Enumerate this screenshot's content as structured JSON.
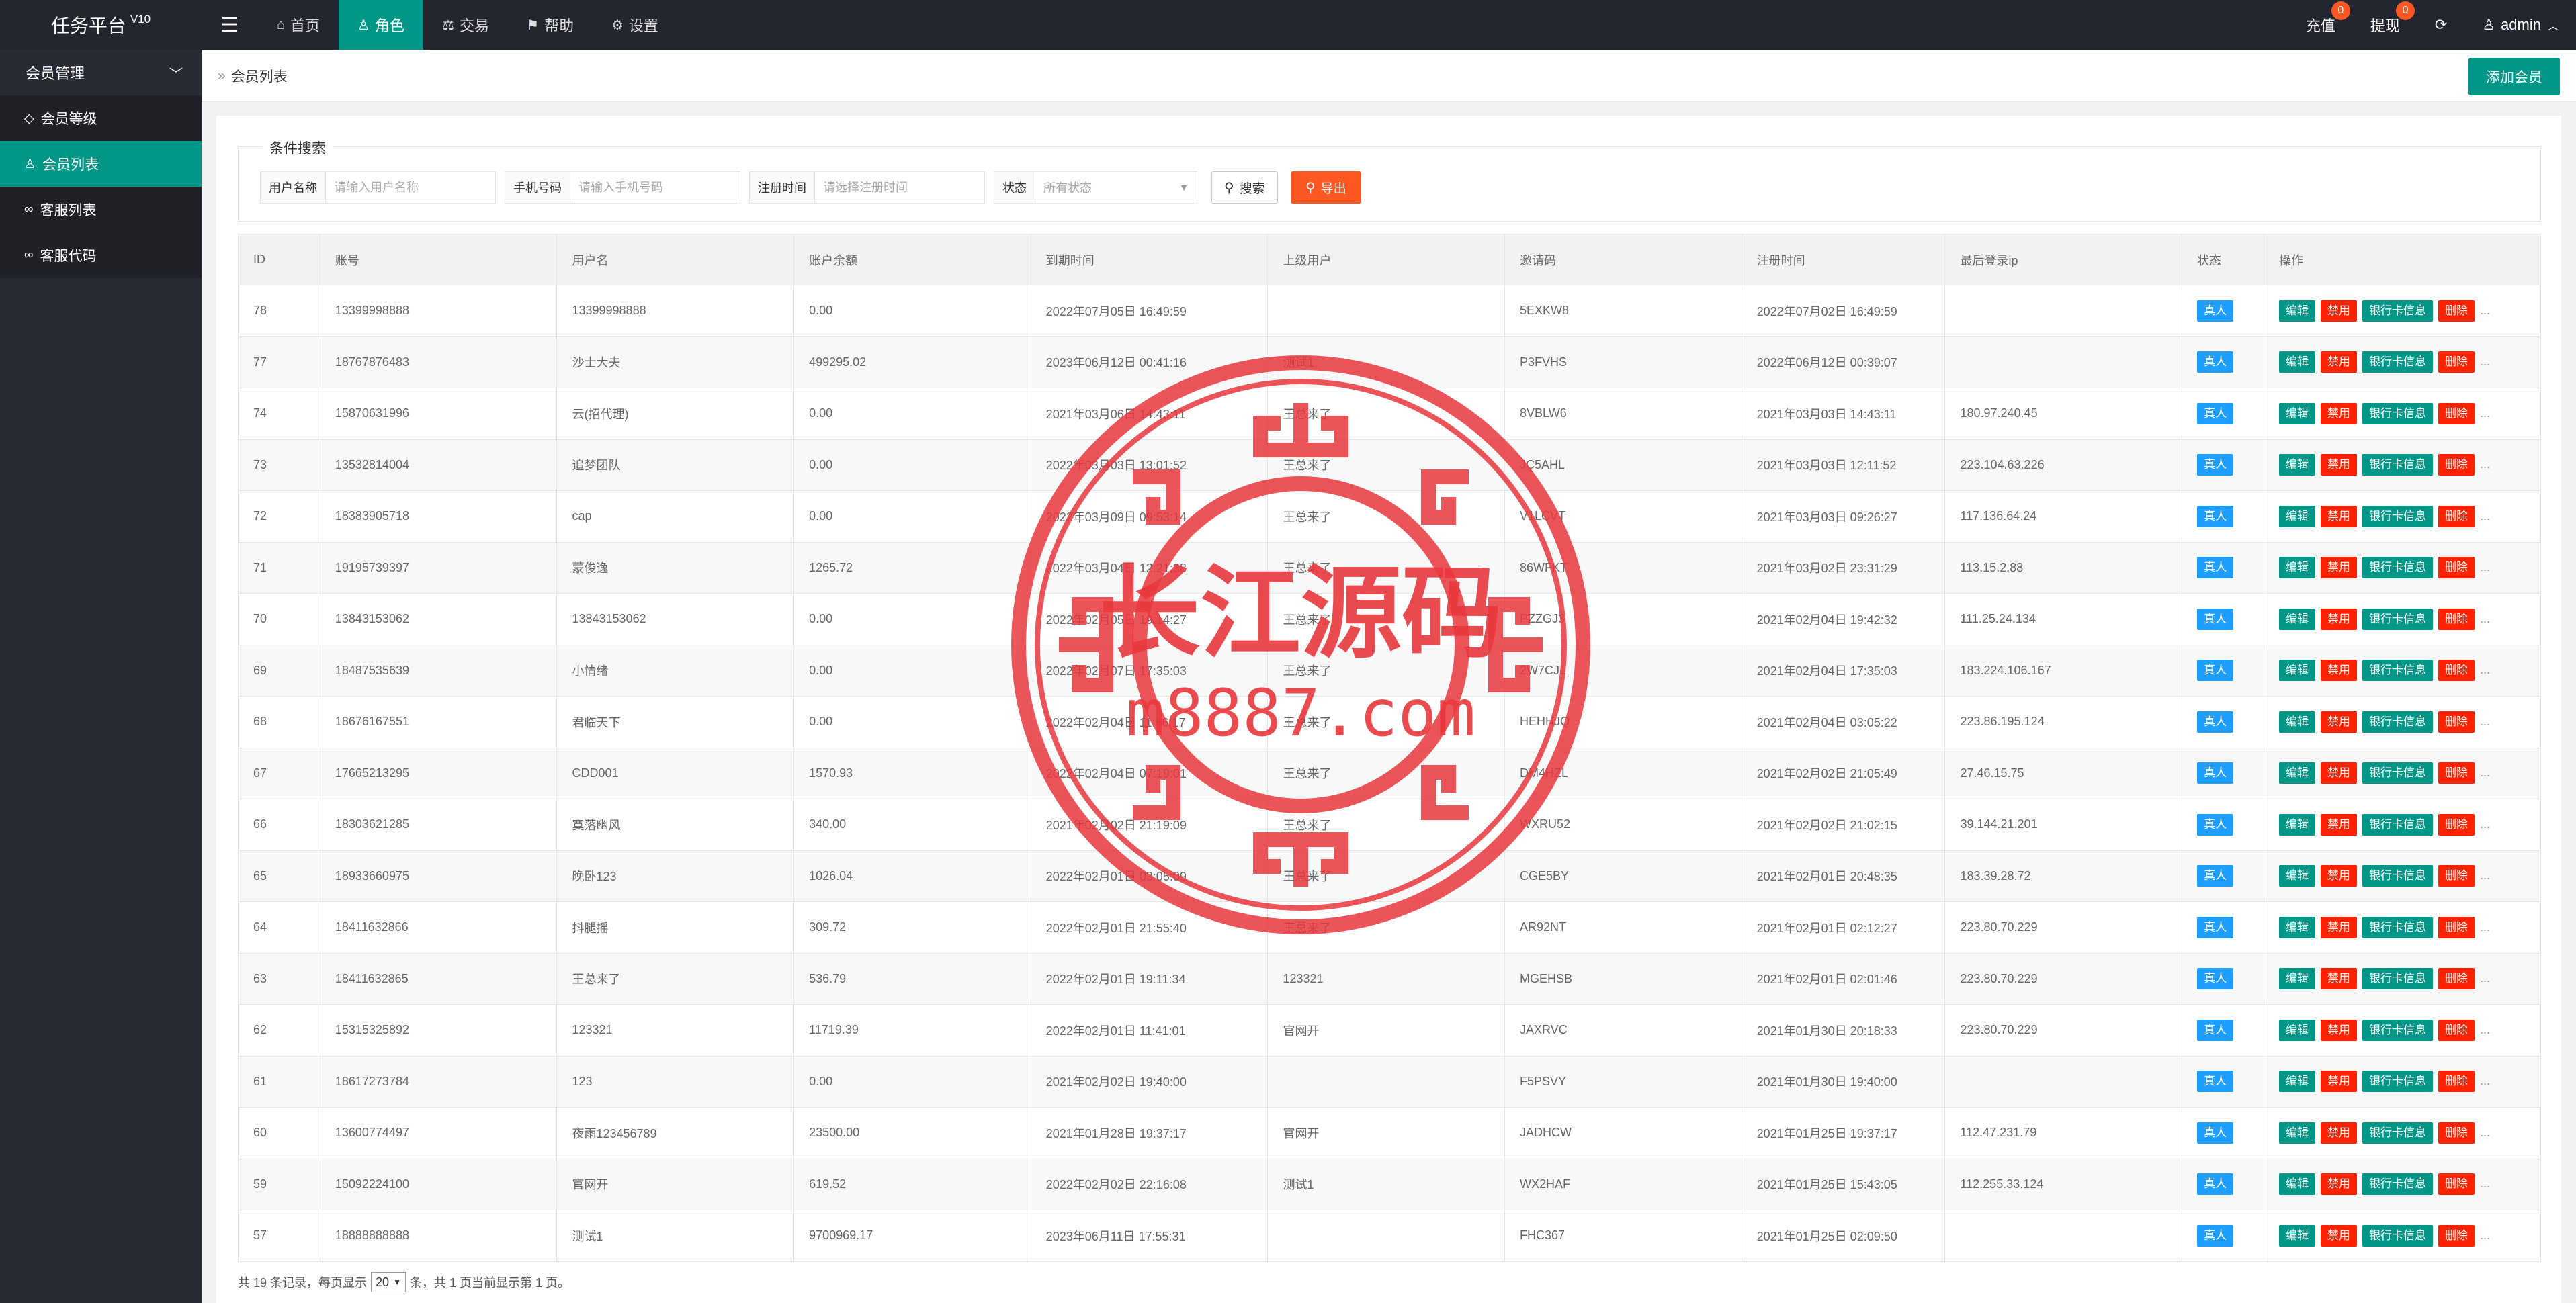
{
  "app": {
    "title": "任务平台",
    "version": "V10"
  },
  "topnav": [
    {
      "icon": "home-icon",
      "glyph": "⌂",
      "label": "首页",
      "active": false
    },
    {
      "icon": "user-icon",
      "glyph": "♙",
      "label": "角色",
      "active": true
    },
    {
      "icon": "scale-icon",
      "glyph": "⚖",
      "label": "交易",
      "active": false
    },
    {
      "icon": "flag-icon",
      "glyph": "⚑",
      "label": "帮助",
      "active": false
    },
    {
      "icon": "gear-icon",
      "glyph": "⚙",
      "label": "设置",
      "active": false
    }
  ],
  "topright": {
    "recharge": {
      "label": "充值",
      "badge": "0"
    },
    "withdraw": {
      "label": "提现",
      "badge": "0"
    },
    "user": "admin"
  },
  "sidebar": {
    "group": "会员管理",
    "items": [
      {
        "icon": "diamond-icon",
        "glyph": "◇",
        "label": "会员等级",
        "active": false
      },
      {
        "icon": "user-icon",
        "glyph": "♙",
        "label": "会员列表",
        "active": true
      },
      {
        "icon": "link-icon",
        "glyph": "∞",
        "label": "客服列表",
        "active": false
      },
      {
        "icon": "link-icon",
        "glyph": "∞",
        "label": "客服代码",
        "active": false
      }
    ]
  },
  "breadcrumb": "会员列表",
  "add_button": "添加会员",
  "search": {
    "legend": "条件搜索",
    "username": {
      "label": "用户名称",
      "placeholder": "请输入用户名称"
    },
    "phone": {
      "label": "手机号码",
      "placeholder": "请输入手机号码"
    },
    "regtime": {
      "label": "注册时间",
      "placeholder": "请选择注册时间"
    },
    "status": {
      "label": "状态",
      "value": "所有状态"
    },
    "search_button": "搜索",
    "export_button": "导出"
  },
  "table": {
    "headers": [
      "ID",
      "账号",
      "用户名",
      "账户余额",
      "到期时间",
      "上级用户",
      "邀请码",
      "注册时间",
      "最后登录ip",
      "状态",
      "操作"
    ],
    "status_label": "真人",
    "actions": {
      "edit": "编辑",
      "ban": "禁用",
      "bank": "银行卡信息",
      "del": "删除",
      "more": "..."
    },
    "rows": [
      [
        "78",
        "13399998888",
        "13399998888",
        "0.00",
        "2022年07月05日 16:49:59",
        "",
        "5EXKW8",
        "2022年07月02日 16:49:59",
        ""
      ],
      [
        "77",
        "18767876483",
        "沙士大夫",
        "499295.02",
        "2023年06月12日 00:41:16",
        "测试1",
        "P3FVHS",
        "2022年06月12日 00:39:07",
        ""
      ],
      [
        "74",
        "15870631996",
        "云(招代理)",
        "0.00",
        "2021年03月06日 14:43:11",
        "王总来了",
        "8VBLW6",
        "2021年03月03日 14:43:11",
        "180.97.240.45"
      ],
      [
        "73",
        "13532814004",
        "追梦团队",
        "0.00",
        "2022年03月03日 13:01:52",
        "王总来了",
        "JC5AHL",
        "2021年03月03日 12:11:52",
        "223.104.63.226"
      ],
      [
        "72",
        "18383905718",
        "cap",
        "0.00",
        "2022年03月09日 09:53:14",
        "王总来了",
        "V1LCVT",
        "2021年03月03日 09:26:27",
        "117.136.64.24"
      ],
      [
        "71",
        "19195739397",
        "蒙俊逸",
        "1265.72",
        "2022年03月04日 12:21:38",
        "王总来了",
        "86WFKT",
        "2021年03月02日 23:31:29",
        "113.15.2.88"
      ],
      [
        "70",
        "13843153062",
        "13843153062",
        "0.00",
        "2022年02月05日 19:14:27",
        "王总来了",
        "PZZGJ3",
        "2021年02月04日 19:42:32",
        "111.25.24.134"
      ],
      [
        "69",
        "18487535639",
        "小情绪",
        "0.00",
        "2022年02月07日 17:35:03",
        "王总来了",
        "2W7CJ1",
        "2021年02月04日 17:35:03",
        "183.224.106.167"
      ],
      [
        "68",
        "18676167551",
        "君临天下",
        "0.00",
        "2022年02月04日 11:56:17",
        "王总来了",
        "HEHHJQ",
        "2021年02月04日 03:05:22",
        "223.86.195.124"
      ],
      [
        "67",
        "17665213295",
        "CDD001",
        "1570.93",
        "2022年02月04日 07:19:01",
        "王总来了",
        "DM4HZL",
        "2021年02月02日 21:05:49",
        "27.46.15.75"
      ],
      [
        "66",
        "18303621285",
        "寞落幽风",
        "340.00",
        "2021年02月02日 21:19:09",
        "王总来了",
        "WXRU52",
        "2021年02月02日 21:02:15",
        "39.144.21.201"
      ],
      [
        "65",
        "18933660975",
        "晚卧123",
        "1026.04",
        "2022年02月01日 03:05:09",
        "王总来了",
        "CGE5BY",
        "2021年02月01日 20:48:35",
        "183.39.28.72"
      ],
      [
        "64",
        "18411632866",
        "抖腿摇",
        "309.72",
        "2022年02月01日 21:55:40",
        "王总来了",
        "AR92NT",
        "2021年02月01日 02:12:27",
        "223.80.70.229"
      ],
      [
        "63",
        "18411632865",
        "王总来了",
        "536.79",
        "2022年02月01日 19:11:34",
        "123321",
        "MGEHSB",
        "2021年02月01日 02:01:46",
        "223.80.70.229"
      ],
      [
        "62",
        "15315325892",
        "123321",
        "11719.39",
        "2022年02月01日 11:41:01",
        "官网开",
        "JAXRVC",
        "2021年01月30日 20:18:33",
        "223.80.70.229"
      ],
      [
        "61",
        "18617273784",
        "123",
        "0.00",
        "2021年02月02日 19:40:00",
        "",
        "F5PSVY",
        "2021年01月30日 19:40:00",
        ""
      ],
      [
        "60",
        "13600774497",
        "夜雨123456789",
        "23500.00",
        "2021年01月28日 19:37:17",
        "官网开",
        "JADHCW",
        "2021年01月25日 19:37:17",
        "112.47.231.79"
      ],
      [
        "59",
        "15092224100",
        "官网开",
        "619.52",
        "2022年02月02日 22:16:08",
        "测试1",
        "WX2HAF",
        "2021年01月25日 15:43:05",
        "112.255.33.124"
      ],
      [
        "57",
        "18888888888",
        "测试1",
        "9700969.17",
        "2023年06月11日 17:55:31",
        "",
        "FHC367",
        "2021年01月25日 02:09:50",
        ""
      ]
    ]
  },
  "pager": {
    "before": "共 19 条记录，每页显示",
    "size": "20",
    "after": "条，共 1 页当前显示第 1 页。"
  },
  "watermark": {
    "text": "长江源码",
    "url": "m8887.com",
    "color": "#e8383d"
  }
}
